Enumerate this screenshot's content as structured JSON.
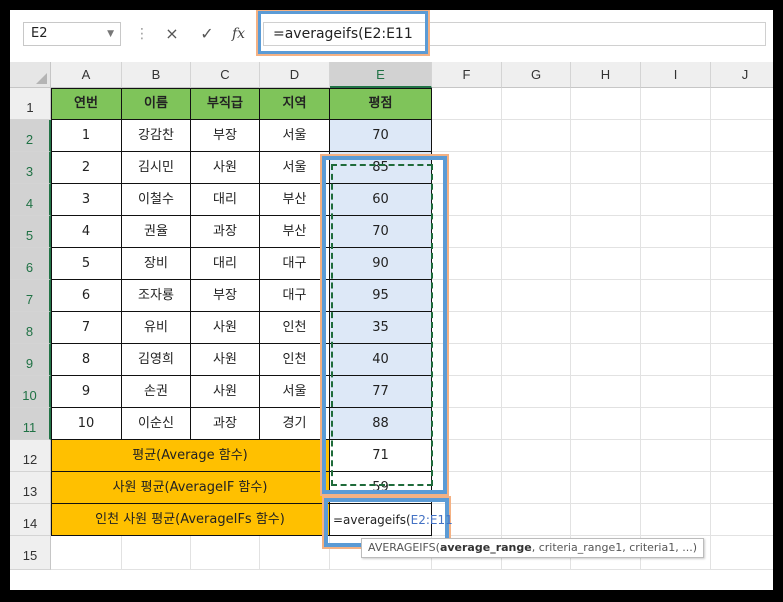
{
  "formula_bar": {
    "name_box": "E2",
    "formula": "=averageifs(E2:E11",
    "cancel_icon": "×",
    "enter_icon": "✓",
    "fx_label": "fx"
  },
  "columns": [
    "A",
    "B",
    "C",
    "D",
    "E",
    "F",
    "G",
    "H",
    "I",
    "J"
  ],
  "rows": [
    "1",
    "2",
    "3",
    "4",
    "5",
    "6",
    "7",
    "8",
    "9",
    "10",
    "11",
    "12",
    "13",
    "14",
    "15"
  ],
  "table": {
    "headers": [
      "연번",
      "이름",
      "부직급",
      "지역",
      "평점"
    ],
    "records": [
      [
        "1",
        "강감찬",
        "부장",
        "서울",
        "70"
      ],
      [
        "2",
        "김시민",
        "사원",
        "서울",
        "85"
      ],
      [
        "3",
        "이철수",
        "대리",
        "부산",
        "60"
      ],
      [
        "4",
        "권율",
        "과장",
        "부산",
        "70"
      ],
      [
        "5",
        "장비",
        "대리",
        "대구",
        "90"
      ],
      [
        "6",
        "조자룡",
        "부장",
        "대구",
        "95"
      ],
      [
        "7",
        "유비",
        "사원",
        "인천",
        "35"
      ],
      [
        "8",
        "김영희",
        "사원",
        "인천",
        "40"
      ],
      [
        "9",
        "손권",
        "사원",
        "서울",
        "77"
      ],
      [
        "10",
        "이순신",
        "과장",
        "경기",
        "88"
      ]
    ],
    "summary": [
      {
        "label": "평균(Average 함수)",
        "value": "71"
      },
      {
        "label": "사원 평균(AverageIF 함수)",
        "value": "59"
      },
      {
        "label": "인천 사원 평균(AverageIFs 함수)",
        "value": ""
      }
    ]
  },
  "editing_cell": {
    "prefix": "=averageifs(",
    "ref": "E2:E11"
  },
  "tooltip": {
    "fn": "AVERAGEIFS(",
    "bold_arg": "average_range",
    "rest": ", criteria_range1, criteria1, ...)"
  },
  "colors": {
    "header_green": "#7fc45a",
    "summary_yellow": "#ffc000",
    "range_blue": "#dde8f7",
    "highlight_border": "#5b9bd5",
    "highlight_glow": "#f4b183"
  }
}
